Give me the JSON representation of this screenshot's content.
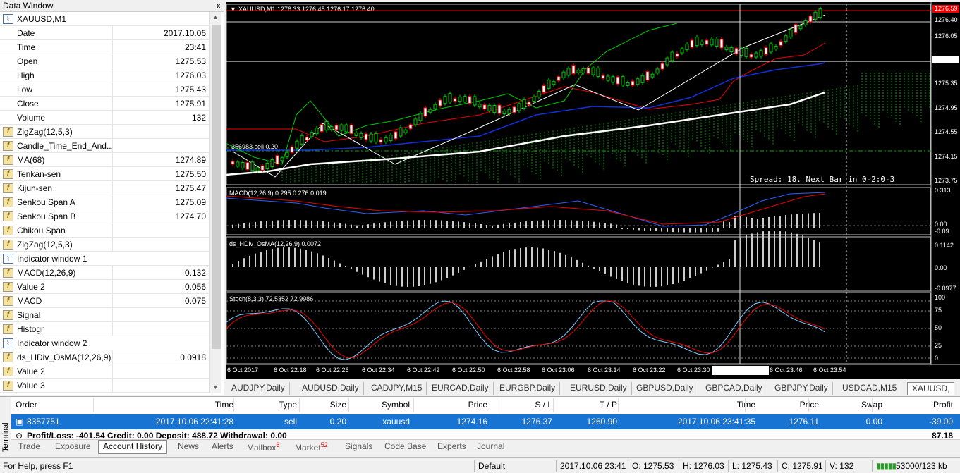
{
  "data_window": {
    "title": "Data Window",
    "close": "x",
    "rows": [
      {
        "icon": "chart-window-icon",
        "label": "XAUUSD,M1",
        "value": ""
      },
      {
        "icon": "",
        "label": "Date",
        "value": "2017.10.06"
      },
      {
        "icon": "",
        "label": "Time",
        "value": "23:41"
      },
      {
        "icon": "",
        "label": "Open",
        "value": "1275.53"
      },
      {
        "icon": "",
        "label": "High",
        "value": "1276.03"
      },
      {
        "icon": "",
        "label": "Low",
        "value": "1275.43"
      },
      {
        "icon": "",
        "label": "Close",
        "value": "1275.91"
      },
      {
        "icon": "",
        "label": "Volume",
        "value": "132"
      },
      {
        "icon": "indicator-icon",
        "label": "ZigZag(12,5,3)",
        "value": ""
      },
      {
        "icon": "indicator-icon",
        "label": "Candle_Time_End_And...",
        "value": ""
      },
      {
        "icon": "indicator-icon",
        "label": "MA(68)",
        "value": "1274.89"
      },
      {
        "icon": "indicator-icon",
        "label": "Tenkan-sen",
        "value": "1275.50"
      },
      {
        "icon": "indicator-icon",
        "label": "Kijun-sen",
        "value": "1275.47"
      },
      {
        "icon": "indicator-icon",
        "label": "Senkou Span A",
        "value": "1275.09"
      },
      {
        "icon": "indicator-icon",
        "label": "Senkou Span B",
        "value": "1274.70"
      },
      {
        "icon": "indicator-icon",
        "label": "Chikou Span",
        "value": ""
      },
      {
        "icon": "indicator-icon",
        "label": "ZigZag(12,5,3)",
        "value": ""
      },
      {
        "icon": "chart-window-icon",
        "label": "Indicator window 1",
        "value": ""
      },
      {
        "icon": "indicator-icon",
        "label": "MACD(12,26,9)",
        "value": "0.132"
      },
      {
        "icon": "indicator-icon",
        "label": "Value 2",
        "value": "0.056"
      },
      {
        "icon": "indicator-icon",
        "label": "MACD",
        "value": "0.075"
      },
      {
        "icon": "indicator-icon",
        "label": "Signal",
        "value": ""
      },
      {
        "icon": "indicator-icon",
        "label": "Histogr",
        "value": ""
      },
      {
        "icon": "chart-window-icon",
        "label": "Indicator window 2",
        "value": ""
      },
      {
        "icon": "indicator-icon",
        "label": "ds_HDiv_OsMA(12,26,9)",
        "value": "0.0918"
      },
      {
        "icon": "indicator-icon",
        "label": "Value 2",
        "value": ""
      },
      {
        "icon": "indicator-icon",
        "label": "Value 3",
        "value": ""
      }
    ]
  },
  "chart": {
    "header": "XAUUSD,M1  1276.33 1276.45 1276.17 1276.40",
    "symbol_arrow": "▼",
    "price_labels": [
      "1276.59",
      "1276.40",
      "1276.05",
      "1275.75",
      "1275.35",
      "1274.95",
      "1274.55",
      "1274.15",
      "1273.75"
    ],
    "order_label": "356983 sell 0.20",
    "spread_text": "Spread: 18. Next Bar in 0-2:0-3",
    "macd_header": "MACD(12,26,9) 0.295 0.276 0.019",
    "macd_labels": [
      "0.313",
      "0.00",
      "-0.09"
    ],
    "osma_header": "ds_HDiv_OsMA(12,26,9) 0.0072",
    "osma_labels": [
      "0.1142",
      "0.00",
      "-0.0977"
    ],
    "stoch_header": "Stoch(8,3,3) 72.5352 72.9986",
    "stoch_labels": [
      "100",
      "75",
      "50",
      "25",
      "0"
    ],
    "time_labels": [
      "6 Oct 2017",
      "6 Oct 22:18",
      "6 Oct 22:26",
      "6 Oct 22:34",
      "6 Oct 22:42",
      "6 Oct 22:50",
      "6 Oct 22:58",
      "6 Oct 23:06",
      "6 Oct 23:14",
      "6 Oct 23:22",
      "6 Oct 23:30",
      "6 Oct 23:46",
      "6 Oct 23:54"
    ],
    "crosshair_time": "2017.10.06 23:41",
    "colors": {
      "bg": "#000000",
      "up": "#00ff00",
      "down": "#ff0000",
      "ma": "#ffffff",
      "tenkan": "#ff0000",
      "kijun": "#0000ff",
      "chikou": "#00ff00"
    }
  },
  "symbol_tabs": [
    "AUDJPY,Daily",
    "AUDUSD,Daily",
    "CADJPY,M15",
    "EURCAD,Daily",
    "EURGBP,Daily",
    "EURUSD,Daily",
    "GBPUSD,Daily",
    "GBPCAD,Daily",
    "GBPJPY,Daily",
    "USDCAD,M15",
    "XAUUSD,"
  ],
  "terminal": {
    "side_label": "Terminal",
    "columns": [
      "Order",
      "Time",
      "Type",
      "Size",
      "Symbol",
      "Price",
      "S / L",
      "T / P",
      "Time",
      "Price",
      "Swap",
      "Profit"
    ],
    "row": {
      "order": "8357751",
      "time": "2017.10.06 22:41:28",
      "type": "sell",
      "size": "0.20",
      "symbol": "xauusd",
      "price": "1274.16",
      "sl": "1276.37",
      "tp": "1260.90",
      "close_time": "2017.10.06 23:41:35",
      "close_price": "1276.11",
      "swap": "0.00",
      "profit": "-39.00"
    },
    "summary": "Profit/Loss: -401.54  Credit: 0.00  Deposit: 488.72  Withdrawal: 0.00",
    "summary_value": "87.18",
    "tabs": [
      {
        "label": "Trade",
        "badge": ""
      },
      {
        "label": "Exposure",
        "badge": ""
      },
      {
        "label": "Account History",
        "badge": ""
      },
      {
        "label": "News",
        "badge": ""
      },
      {
        "label": "Alerts",
        "badge": ""
      },
      {
        "label": "Mailbox",
        "badge": "6"
      },
      {
        "label": "Market",
        "badge": "52"
      },
      {
        "label": "Signals",
        "badge": ""
      },
      {
        "label": "Code Base",
        "badge": ""
      },
      {
        "label": "Experts",
        "badge": ""
      },
      {
        "label": "Journal",
        "badge": ""
      }
    ]
  },
  "status": {
    "help": "For Help, press F1",
    "profile": "Default",
    "datetime": "2017.10.06 23:41",
    "open": "O: 1275.53",
    "high": "H: 1276.03",
    "low": "L: 1275.43",
    "close": "C: 1275.91",
    "volume": "V: 132",
    "traffic": "53000/123 kb"
  }
}
